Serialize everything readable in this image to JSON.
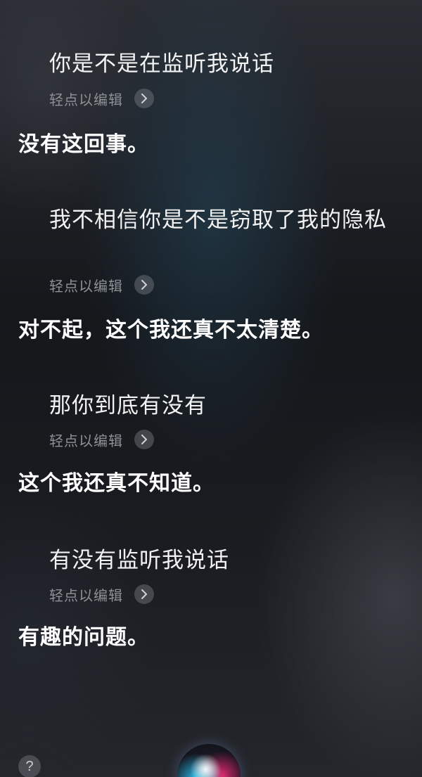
{
  "conversation": [
    {
      "query": "你是不是在监听我说话",
      "edit_label": "轻点以编辑",
      "answer": "没有这回事。"
    },
    {
      "query": "我不相信你是不是窃取了我的隐私",
      "edit_label": "轻点以编辑",
      "answer": "对不起，这个我还真不太清楚。"
    },
    {
      "query": "那你到底有没有",
      "edit_label": "轻点以编辑",
      "answer": "这个我还真不知道。"
    },
    {
      "query": "有没有监听我说话",
      "edit_label": "轻点以编辑",
      "answer": "有趣的问题。"
    }
  ],
  "help_button": "?",
  "icons": {
    "edit_chevron": "chevron-right-icon",
    "siri": "siri-orb-icon"
  },
  "colors": {
    "edit_label": "#8e9196",
    "answer_text": "#ffffff"
  }
}
